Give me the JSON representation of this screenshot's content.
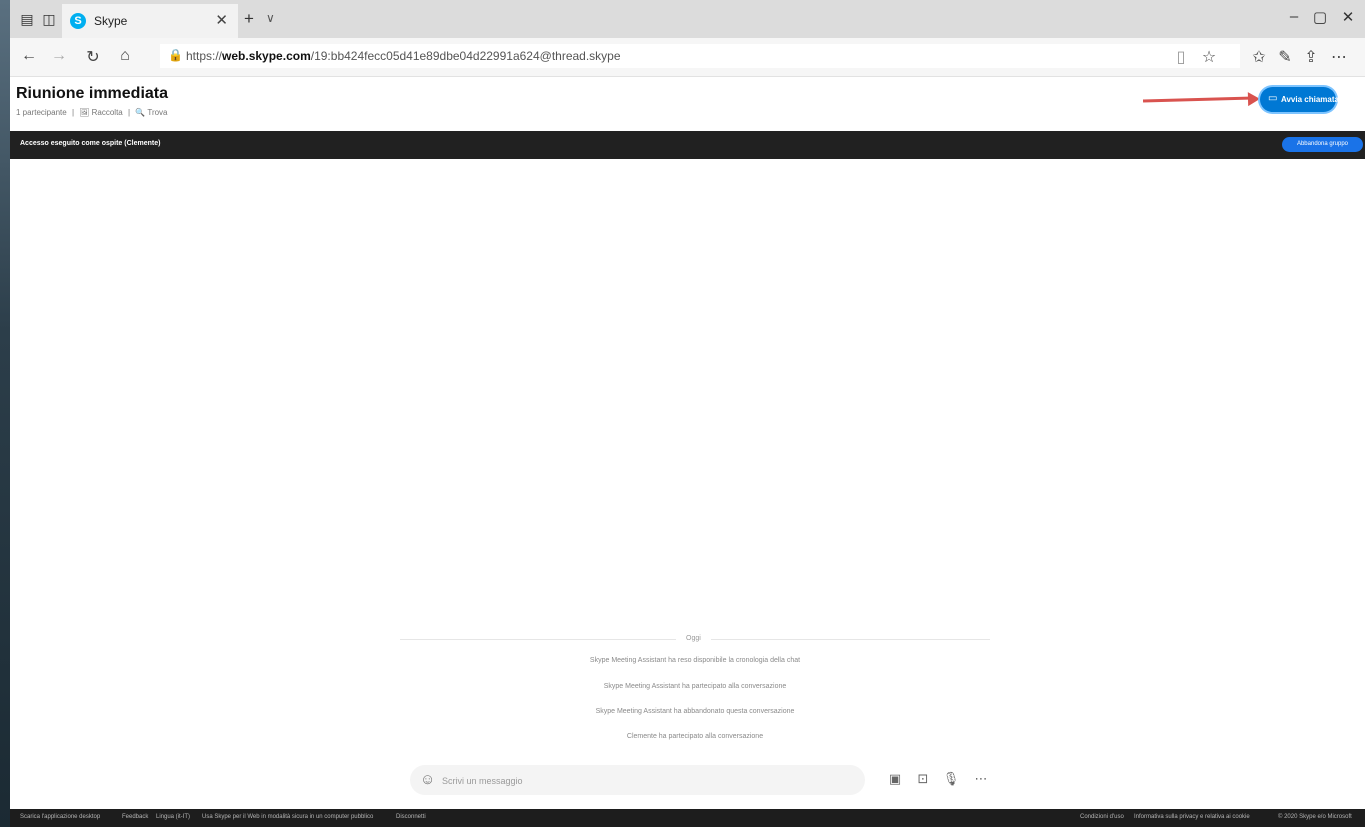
{
  "browser": {
    "tab_title": "Skype",
    "tab_favicon": "S",
    "url_prefix": "https://",
    "url_domain": "web.skype.com",
    "url_path": "/19:bb424fecc05d41e89dbe04d22991a624@thread.skype",
    "icons": {
      "back": "←",
      "forward": "→",
      "refresh": "↻",
      "home": "⌂",
      "lock": "🔒",
      "reading": "▯",
      "favorite": "☆",
      "favorites": "✩",
      "pen": "✎",
      "share": "⇪",
      "more": "⋯",
      "tab_close": "✕",
      "new_tab": "+",
      "tab_menu": "∨",
      "minimize": "–",
      "maximize": "▢",
      "close": "✕"
    }
  },
  "header": {
    "title": "Riunione immediata",
    "participants": "1 partecipante",
    "gallery": "🖼 Raccolta",
    "find": "🔍 Trova",
    "separator": "|",
    "call_button": "Avvia chiamata",
    "call_icon": "▭"
  },
  "guest_bar": {
    "text": "Accesso eseguito come ospite (Clemente)",
    "leave_button": "Abbandona gruppo"
  },
  "chat": {
    "date_label": "Oggi",
    "system_messages": [
      "Skype Meeting Assistant ha reso disponibile la cronologia della chat",
      "Skype Meeting Assistant ha partecipato alla conversazione",
      "Skype Meeting Assistant ha abbandonato questa conversazione",
      "Clemente ha partecipato alla conversazione"
    ]
  },
  "composer": {
    "placeholder": "Scrivi un messaggio",
    "emoji_icon": "☺",
    "media_icon": "▣",
    "contact_icon": "⊡",
    "mic_icon": "🎙",
    "more_icon": "⋯"
  },
  "footer": {
    "left_links": [
      "Scarica l'applicazione desktop",
      "Feedback",
      "Lingua (it-IT)",
      "Usa Skype per il Web in modalità sicura in un computer pubblico",
      "Disconnetti"
    ],
    "right_links": [
      "Condizioni d'uso",
      "Informativa sulla privacy e relativa ai cookie",
      "© 2020 Skype e/o Microsoft"
    ]
  }
}
